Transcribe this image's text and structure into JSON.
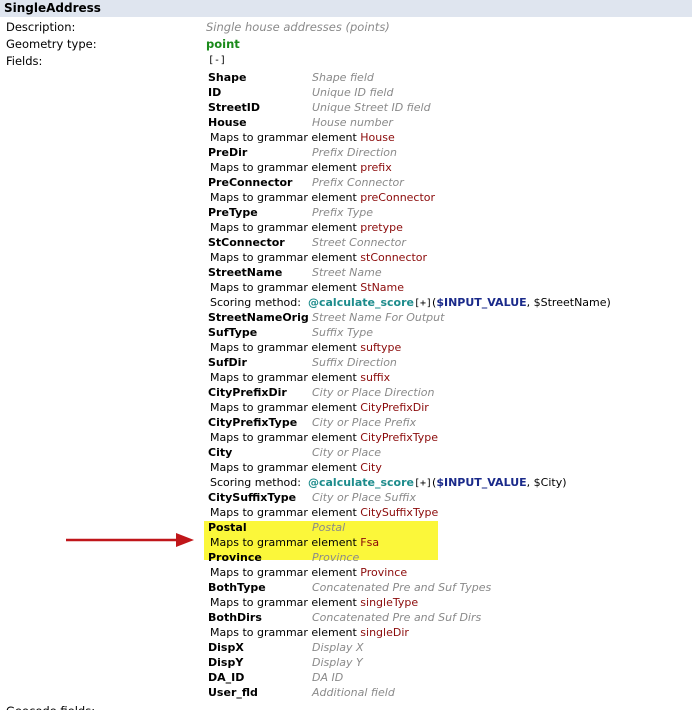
{
  "title": "SingleAddress",
  "labels": {
    "description": "Description:",
    "geometry": "Geometry type:",
    "fields": "Fields:",
    "geocode": "Geocode fields:"
  },
  "description": "Single house addresses (points)",
  "geometry_type": "point",
  "geometry_color": "#1a8a1a",
  "toggle": "[-]",
  "maps_prefix": "Maps to grammar element ",
  "scoring_prefix": "Scoring method:",
  "highlight_color": "#fbf73a",
  "arrow_color": "#c0161a",
  "rows": [
    {
      "type": "field",
      "name": "Shape",
      "desc": "Shape field"
    },
    {
      "type": "field",
      "name": "ID",
      "desc": "Unique ID field"
    },
    {
      "type": "field",
      "name": "StreetID",
      "desc": "Unique Street ID field"
    },
    {
      "type": "field",
      "name": "House",
      "desc": "House number"
    },
    {
      "type": "map",
      "element": "House"
    },
    {
      "type": "field",
      "name": "PreDir",
      "desc": "Prefix Direction"
    },
    {
      "type": "map",
      "element": "prefix"
    },
    {
      "type": "field",
      "name": "PreConnector",
      "desc": "Prefix Connector"
    },
    {
      "type": "map",
      "element": "preConnector"
    },
    {
      "type": "field",
      "name": "PreType",
      "desc": "Prefix Type"
    },
    {
      "type": "map",
      "element": "pretype"
    },
    {
      "type": "field",
      "name": "StConnector",
      "desc": "Street Connector"
    },
    {
      "type": "map",
      "element": "stConnector"
    },
    {
      "type": "field",
      "name": "StreetName",
      "desc": "Street Name"
    },
    {
      "type": "map",
      "element": "StName"
    },
    {
      "type": "score",
      "func": "@calculate_score",
      "plus": "[+]",
      "arg1": "$INPUT_VALUE",
      "arg2": "$StreetName"
    },
    {
      "type": "field",
      "name": "StreetNameOrig",
      "desc": "Street Name For Output"
    },
    {
      "type": "field",
      "name": "SufType",
      "desc": "Suffix Type"
    },
    {
      "type": "map",
      "element": "suftype"
    },
    {
      "type": "field",
      "name": "SufDir",
      "desc": "Suffix Direction"
    },
    {
      "type": "map",
      "element": "suffix"
    },
    {
      "type": "field",
      "name": "CityPrefixDir",
      "desc": "City or Place Direction"
    },
    {
      "type": "map",
      "element": "CityPrefixDir"
    },
    {
      "type": "field",
      "name": "CityPrefixType",
      "desc": "City or Place Prefix"
    },
    {
      "type": "map",
      "element": "CityPrefixType"
    },
    {
      "type": "field",
      "name": "City",
      "desc": "City or Place"
    },
    {
      "type": "map",
      "element": "City"
    },
    {
      "type": "score",
      "func": "@calculate_score",
      "plus": "[+]",
      "arg1": "$INPUT_VALUE",
      "arg2": "$City"
    },
    {
      "type": "field",
      "name": "CitySuffixType",
      "desc": "City or Place Suffix"
    },
    {
      "type": "map",
      "element": "CitySuffixType"
    },
    {
      "type": "field",
      "name": "Postal",
      "desc": "Postal"
    },
    {
      "type": "map",
      "element": "Fsa"
    },
    {
      "type": "field",
      "name": "Province",
      "desc": "Province"
    },
    {
      "type": "map",
      "element": "Province"
    },
    {
      "type": "field",
      "name": "BothType",
      "desc": "Concatenated Pre and Suf Types"
    },
    {
      "type": "map",
      "element": "singleType"
    },
    {
      "type": "field",
      "name": "BothDirs",
      "desc": "Concatenated Pre and Suf Dirs"
    },
    {
      "type": "map",
      "element": "singleDir"
    },
    {
      "type": "field",
      "name": "DispX",
      "desc": "Display X"
    },
    {
      "type": "field",
      "name": "DispY",
      "desc": "Display Y"
    },
    {
      "type": "field",
      "name": "DA_ID",
      "desc": "DA ID"
    },
    {
      "type": "field",
      "name": "User_fld",
      "desc": "Additional field"
    }
  ]
}
